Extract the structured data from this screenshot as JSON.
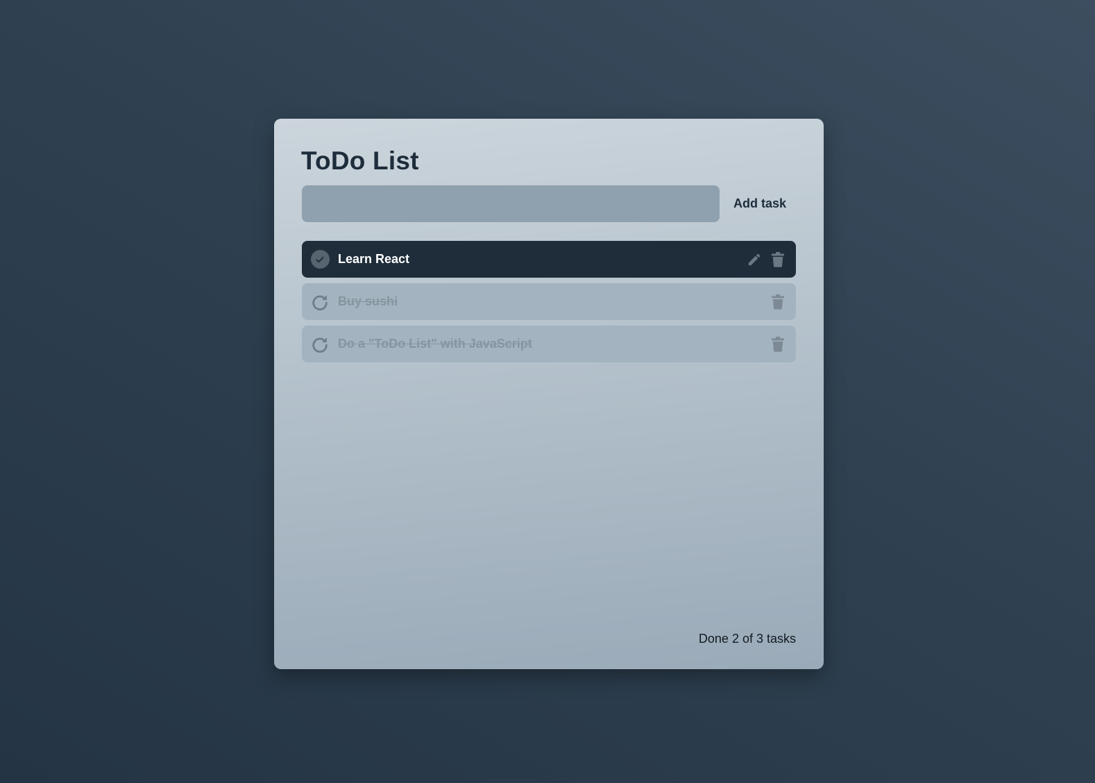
{
  "app": {
    "title": "ToDo List"
  },
  "input": {
    "value": "",
    "placeholder": ""
  },
  "add_button": {
    "label": "Add task"
  },
  "tasks": [
    {
      "label": "Learn React",
      "done": false,
      "status_icon": "check-circle-icon",
      "actions": [
        "pencil-icon",
        "trash-icon"
      ]
    },
    {
      "label": "Buy sushi",
      "done": true,
      "status_icon": "redo-icon",
      "actions": [
        "trash-icon"
      ]
    },
    {
      "label": "Do a \"ToDo List\" with JavaScript",
      "done": true,
      "status_icon": "redo-icon",
      "actions": [
        "trash-icon"
      ]
    }
  ],
  "summary": {
    "text": "Done 2 of 3 tasks"
  },
  "colors": {
    "accent_dark": "#1f2d3a",
    "done_row": "#a3b4c0",
    "input_bg": "#8fa0af"
  }
}
